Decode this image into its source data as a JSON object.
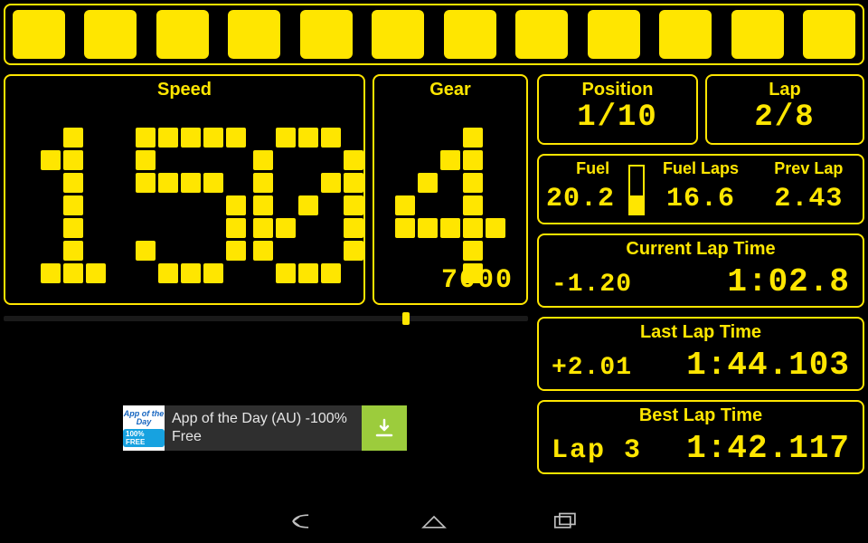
{
  "indicators": {
    "count": 12
  },
  "speed": {
    "label": "Speed",
    "value": "150"
  },
  "gear": {
    "label": "Gear",
    "value": "4",
    "rpm": "7000",
    "rpm_fraction": 0.76
  },
  "position": {
    "label": "Position",
    "value": "1/10"
  },
  "lap": {
    "label": "Lap",
    "value": "2/8"
  },
  "fuel": {
    "fuel_label": "Fuel",
    "fuel_value": "20.2",
    "fuel_fraction": 0.38,
    "laps_label": "Fuel Laps",
    "laps_value": "16.6",
    "prev_label": "Prev Lap",
    "prev_value": "2.43"
  },
  "current_lap": {
    "label": "Current Lap Time",
    "delta": "-1.20",
    "time": "1:02.8"
  },
  "last_lap": {
    "label": "Last Lap Time",
    "delta": "+2.01",
    "time": "1:44.103"
  },
  "best_lap": {
    "label": "Best Lap Time",
    "lapno": "Lap 3",
    "time": "1:42.117"
  },
  "ad": {
    "badge_top": "App of the Day",
    "badge_bot": "100% FREE",
    "text": "App of the Day (AU) -100% Free"
  }
}
